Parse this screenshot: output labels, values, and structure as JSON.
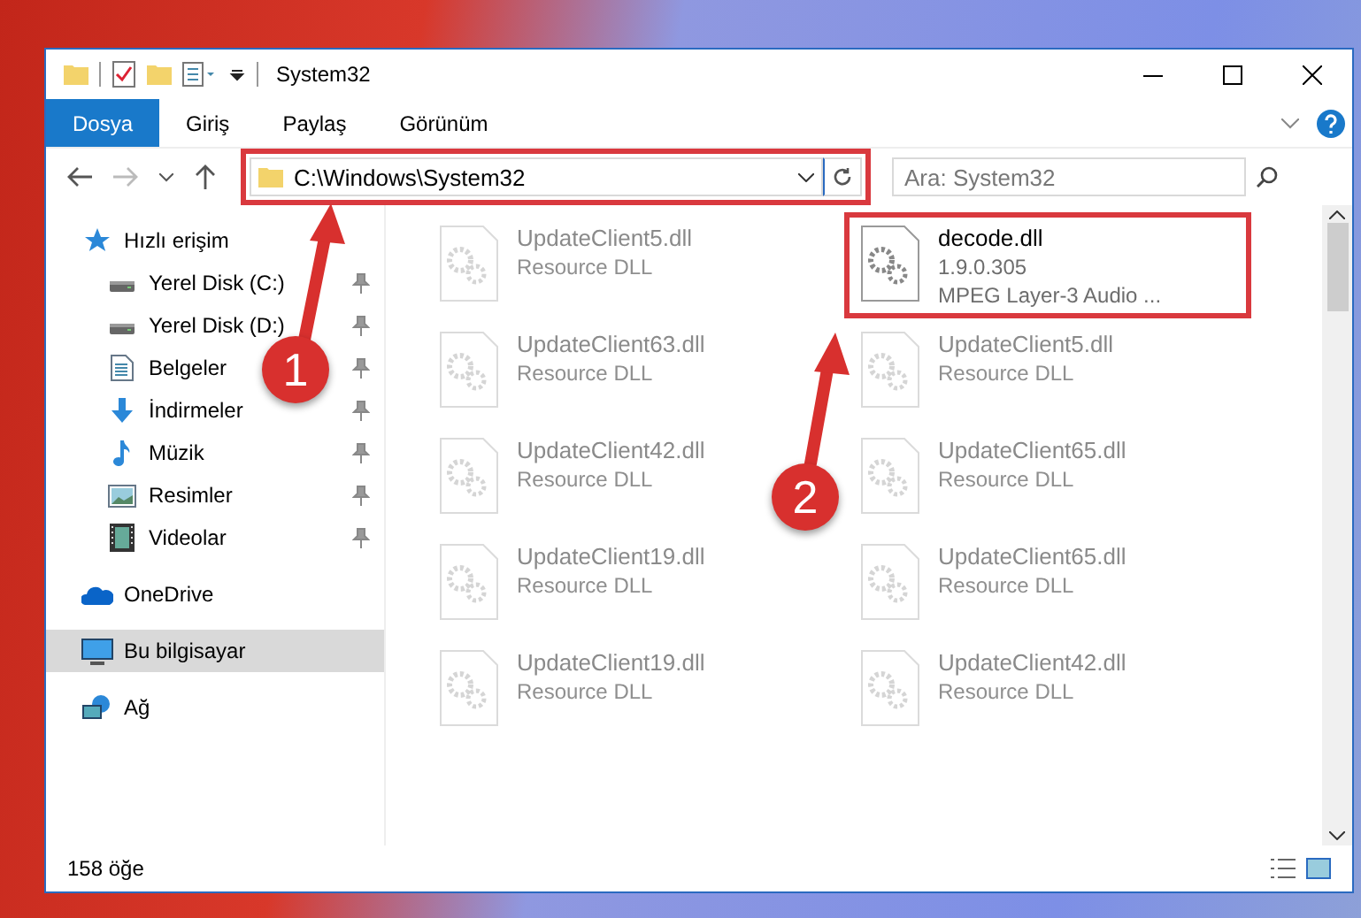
{
  "window": {
    "title": "System32"
  },
  "ribbon_tabs": [
    {
      "label": "Dosya",
      "selected": true
    },
    {
      "label": "Giriş",
      "selected": false
    },
    {
      "label": "Paylaş",
      "selected": false
    },
    {
      "label": "Görünüm",
      "selected": false
    }
  ],
  "address": {
    "path": "C:\\Windows\\System32",
    "framed": true
  },
  "search": {
    "placeholder": "Ara: System32"
  },
  "nav": [
    {
      "label": "Hızlı erişim",
      "kind": "star",
      "selected": false,
      "children": [
        {
          "label": "Yerel Disk (C:)",
          "kind": "drive",
          "selected": false,
          "pinned": true
        },
        {
          "label": "Yerel Disk (D:)",
          "kind": "drive",
          "selected": false,
          "pinned": true
        },
        {
          "label": "Belgeler",
          "kind": "document",
          "selected": false,
          "pinned": true
        },
        {
          "label": "İndirmeler",
          "kind": "download",
          "selected": false,
          "pinned": true
        },
        {
          "label": "Müzik",
          "kind": "music",
          "selected": false,
          "pinned": true
        },
        {
          "label": "Resimler",
          "kind": "picture",
          "selected": false,
          "pinned": true
        },
        {
          "label": "Videolar",
          "kind": "video",
          "selected": false,
          "pinned": true
        }
      ]
    },
    {
      "label": "OneDrive",
      "kind": "cloud",
      "selected": false
    },
    {
      "label": "Bu bilgisayar",
      "kind": "computer",
      "selected": true
    },
    {
      "label": "Ağ",
      "kind": "network",
      "selected": false
    }
  ],
  "files": [
    {
      "name": "UpdateClient5.dll",
      "lines": [
        "Resource DLL"
      ],
      "dimmed": true
    },
    {
      "name": "decode.dll",
      "lines": [
        "1.9.0.305",
        "MPEG Layer-3 Audio ..."
      ],
      "dimmed": false,
      "framed": true
    },
    {
      "name": "UpdateClient63.dll",
      "lines": [
        "Resource DLL"
      ],
      "dimmed": true
    },
    {
      "name": "UpdateClient5.dll",
      "lines": [
        "Resource DLL"
      ],
      "dimmed": true
    },
    {
      "name": "UpdateClient42.dll",
      "lines": [
        "Resource DLL"
      ],
      "dimmed": true
    },
    {
      "name": "UpdateClient65.dll",
      "lines": [
        "Resource DLL"
      ],
      "dimmed": true
    },
    {
      "name": "UpdateClient19.dll",
      "lines": [
        "Resource DLL"
      ],
      "dimmed": true
    },
    {
      "name": "UpdateClient65.dll",
      "lines": [
        "Resource DLL"
      ],
      "dimmed": true
    },
    {
      "name": "UpdateClient19.dll",
      "lines": [
        "Resource DLL"
      ],
      "dimmed": true
    },
    {
      "name": "UpdateClient42.dll",
      "lines": [
        "Resource DLL"
      ],
      "dimmed": true
    }
  ],
  "callouts": [
    {
      "number": "1"
    },
    {
      "number": "2"
    }
  ],
  "status_bar": {
    "item_count": "158 öğe"
  }
}
